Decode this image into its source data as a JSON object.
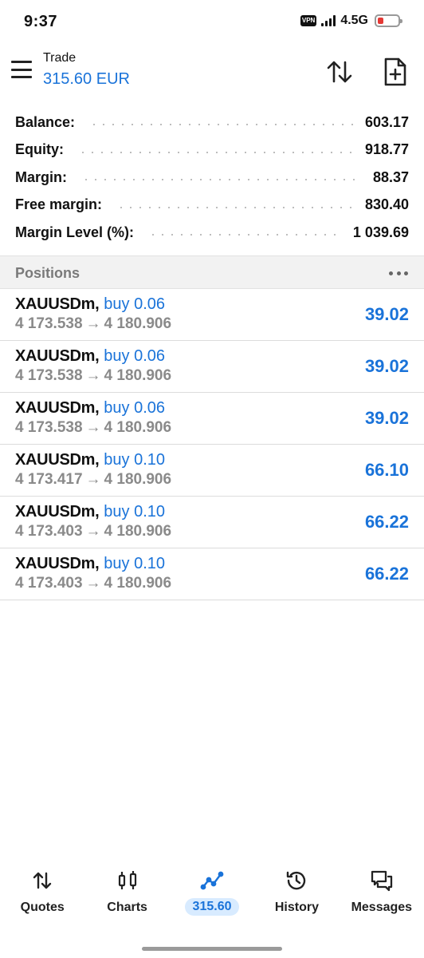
{
  "status_bar": {
    "time": "9:37",
    "vpn": "VPN",
    "network": "4.5G"
  },
  "header": {
    "title": "Trade",
    "subtitle": "315.60 EUR"
  },
  "summary": [
    {
      "label": "Balance:",
      "value": "603.17"
    },
    {
      "label": "Equity:",
      "value": "918.77"
    },
    {
      "label": "Margin:",
      "value": "88.37"
    },
    {
      "label": "Free margin:",
      "value": "830.40"
    },
    {
      "label": "Margin Level (%):",
      "value": "1 039.69"
    }
  ],
  "positions": {
    "title": "Positions",
    "items": [
      {
        "symbol": "XAUUSDm",
        "side": "buy 0.06",
        "open_price": "4 173.538",
        "current_price": "4 180.906",
        "profit": "39.02"
      },
      {
        "symbol": "XAUUSDm",
        "side": "buy 0.06",
        "open_price": "4 173.538",
        "current_price": "4 180.906",
        "profit": "39.02"
      },
      {
        "symbol": "XAUUSDm",
        "side": "buy 0.06",
        "open_price": "4 173.538",
        "current_price": "4 180.906",
        "profit": "39.02"
      },
      {
        "symbol": "XAUUSDm",
        "side": "buy 0.10",
        "open_price": "4 173.417",
        "current_price": "4 180.906",
        "profit": "66.10"
      },
      {
        "symbol": "XAUUSDm",
        "side": "buy 0.10",
        "open_price": "4 173.403",
        "current_price": "4 180.906",
        "profit": "66.22"
      },
      {
        "symbol": "XAUUSDm",
        "side": "buy 0.10",
        "open_price": "4 173.403",
        "current_price": "4 180.906",
        "profit": "66.22"
      }
    ]
  },
  "bottom_nav": [
    {
      "label": "Quotes",
      "icon": "quotes-arrows-icon",
      "active": false
    },
    {
      "label": "Charts",
      "icon": "candlestick-icon",
      "active": false
    },
    {
      "label": "315.60",
      "icon": "trade-line-icon",
      "active": true
    },
    {
      "label": "History",
      "icon": "history-clock-icon",
      "active": false
    },
    {
      "label": "Messages",
      "icon": "messages-chat-icon",
      "active": false
    }
  ],
  "colors": {
    "accent": "#1a73d9",
    "muted_text": "#8a8a8a",
    "section_bg": "#f2f2f2",
    "battery_low": "#e53935"
  }
}
